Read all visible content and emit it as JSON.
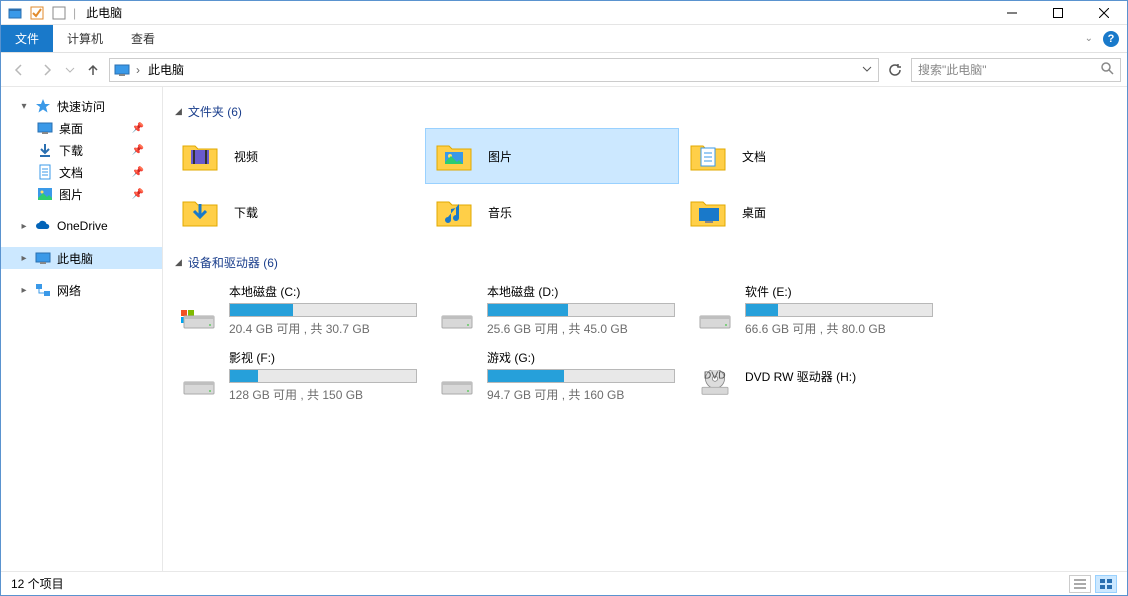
{
  "window": {
    "title": "此电脑"
  },
  "ribbon": {
    "file": "文件",
    "computer": "计算机",
    "view": "查看"
  },
  "address": {
    "location": "此电脑",
    "search_placeholder": "搜索\"此电脑\""
  },
  "sidebar": {
    "quick_access": "快速访问",
    "quick_items": [
      {
        "label": "桌面",
        "icon": "desktop",
        "pinned": true
      },
      {
        "label": "下载",
        "icon": "downloads",
        "pinned": true
      },
      {
        "label": "文档",
        "icon": "documents",
        "pinned": true
      },
      {
        "label": "图片",
        "icon": "pictures",
        "pinned": true
      }
    ],
    "onedrive": "OneDrive",
    "this_pc": "此电脑",
    "network": "网络"
  },
  "content": {
    "folders_header": "文件夹 (6)",
    "folders": [
      {
        "label": "视频",
        "icon": "videos"
      },
      {
        "label": "图片",
        "icon": "pictures",
        "selected": true
      },
      {
        "label": "文档",
        "icon": "documents"
      },
      {
        "label": "下载",
        "icon": "downloads"
      },
      {
        "label": "音乐",
        "icon": "music"
      },
      {
        "label": "桌面",
        "icon": "desktop"
      }
    ],
    "drives_header": "设备和驱动器 (6)",
    "drives": [
      {
        "label": "本地磁盘 (C:)",
        "sub": "20.4 GB 可用 , 共 30.7 GB",
        "fill": 34,
        "type": "os"
      },
      {
        "label": "本地磁盘 (D:)",
        "sub": "25.6 GB 可用 , 共 45.0 GB",
        "fill": 43,
        "type": "hdd"
      },
      {
        "label": "软件 (E:)",
        "sub": "66.6 GB 可用 , 共 80.0 GB",
        "fill": 17,
        "type": "hdd"
      },
      {
        "label": "影视 (F:)",
        "sub": "128 GB 可用 , 共 150 GB",
        "fill": 15,
        "type": "hdd"
      },
      {
        "label": "游戏 (G:)",
        "sub": "94.7 GB 可用 , 共 160 GB",
        "fill": 41,
        "type": "hdd"
      },
      {
        "label": "DVD RW 驱动器 (H:)",
        "sub": "",
        "fill": -1,
        "type": "dvd"
      }
    ]
  },
  "status": {
    "text": "12 个项目"
  }
}
